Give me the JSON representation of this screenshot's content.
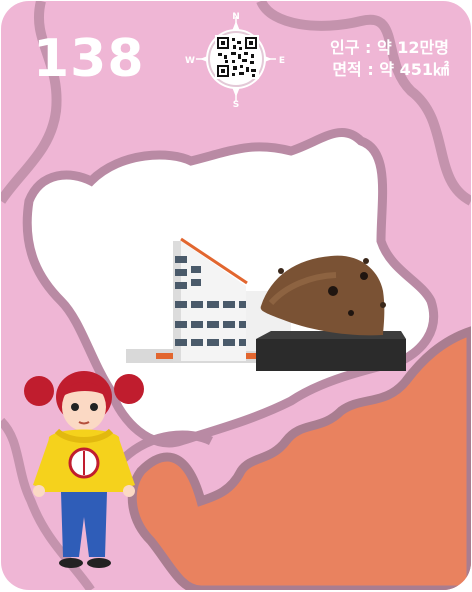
{
  "card": {
    "number": "138",
    "population": "인구 : 약 12만명",
    "area": "면적 : 약 451㎢"
  },
  "compass": {
    "north": "N",
    "south": "S",
    "east": "E",
    "west": "W"
  },
  "icons": {
    "qr": "qr-code-icon",
    "compass": "compass-icon",
    "helmet": "helmet-monument-icon",
    "building": "museum-building-icon",
    "character": "girl-character-icon"
  },
  "colors": {
    "card_bg": "#efb6d5",
    "map_outline": "#b98aa4",
    "highlight_region": "#e9825f",
    "white": "#ffffff"
  }
}
